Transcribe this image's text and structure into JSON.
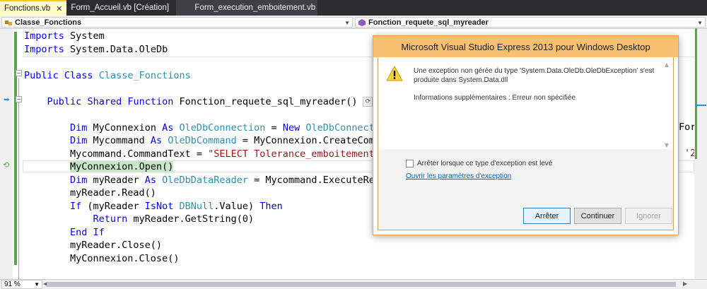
{
  "tabs": [
    {
      "label": "Fonctions.vb",
      "active": true
    },
    {
      "label": "Form_Accueil.vb [Création]",
      "active": false
    },
    {
      "label": "Form_execution_emboitement.vb",
      "active": false
    }
  ],
  "navbar": {
    "left_combo": "Classe_Fonctions",
    "right_combo": "Fonction_requete_sql_myreader"
  },
  "code_lines": [
    {
      "id": "l1",
      "html": "<span class='kw'>Imports</span> System"
    },
    {
      "id": "l2",
      "html": "<span class='kw'>Imports</span> System.Data.OleDb"
    },
    {
      "id": "l3",
      "html": ""
    },
    {
      "id": "l4",
      "html": "<span class='kw'>Public</span> <span class='kw'>Class</span> <span class='ty'>Classe_Fonctions</span>"
    },
    {
      "id": "l5",
      "html": ""
    },
    {
      "id": "l6",
      "html": "    <span class='kw'>Public</span> <span class='kw'>Shared</span> <span class='kw'>Function</span> Fonction_requete_sql_myreader()"
    },
    {
      "id": "l7",
      "html": ""
    },
    {
      "id": "l8",
      "html": "        <span class='kw'>Dim</span> MyConnexion <span class='kw'>As</span> <span class='ty'>OleDbConnection</span> = <span class='kw'>New</span> <span class='ty'>OleDbConnecti</span>"
    },
    {
      "id": "l9",
      "html": "        <span class='kw'>Dim</span> Mycommand <span class='kw'>As</span> <span class='ty'>OleDbCommand</span> = MyConnexion.CreateComm"
    },
    {
      "id": "l10",
      "html": "        Mycommand.CommandText = <span class='st'>\"SELECT Tolerance_emboitement</span>"
    },
    {
      "id": "l11",
      "html": "        <span class='hl'>MyConnexion.Open()</span>"
    },
    {
      "id": "l12",
      "html": "        <span class='kw'>Dim</span> myReader <span class='kw'>As</span> <span class='ty'>OleDbDataReader</span> = Mycommand.ExecuteRea"
    },
    {
      "id": "l13",
      "html": "        myReader.Read()"
    },
    {
      "id": "l14",
      "html": "        <span class='kw'>If</span> (myReader <span class='kw'>IsNot</span> <span class='ty'>DBNull</span>.Value) <span class='kw'>Then</span>"
    },
    {
      "id": "l15",
      "html": "            <span class='kw'>Return</span> myReader.GetString(0)"
    },
    {
      "id": "l16",
      "html": "        <span class='kw'>End</span> <span class='kw'>If</span>"
    },
    {
      "id": "l17",
      "html": "        myReader.Close()"
    },
    {
      "id": "l18",
      "html": "        MyConnexion.Close()"
    }
  ],
  "right_overflow": {
    "fragment1": "For",
    "fragment2": "'2"
  },
  "status": {
    "zoom": "91 %"
  },
  "dialog": {
    "title": "Microsoft Visual Studio Express 2013 pour Windows Desktop",
    "message": "Une exception non gérée du type 'System.Data.OleDb.OleDbException' s'est produite dans System.Data.dll",
    "details": "Informations supplémentaires : Erreur non spécifiée",
    "checkbox_label": "Arrêter lorsque ce type d'exception est levé",
    "checkbox_checked": false,
    "link": "Ouvrir les paramètres d'exception",
    "buttons": {
      "break": "Arrêter",
      "continue": "Continuer",
      "ignore": "Ignorer"
    }
  },
  "colors": {
    "keyword": "#0000ff",
    "type": "#2b91af",
    "string": "#a31515",
    "dialog_title_bg": "#f8c070"
  }
}
